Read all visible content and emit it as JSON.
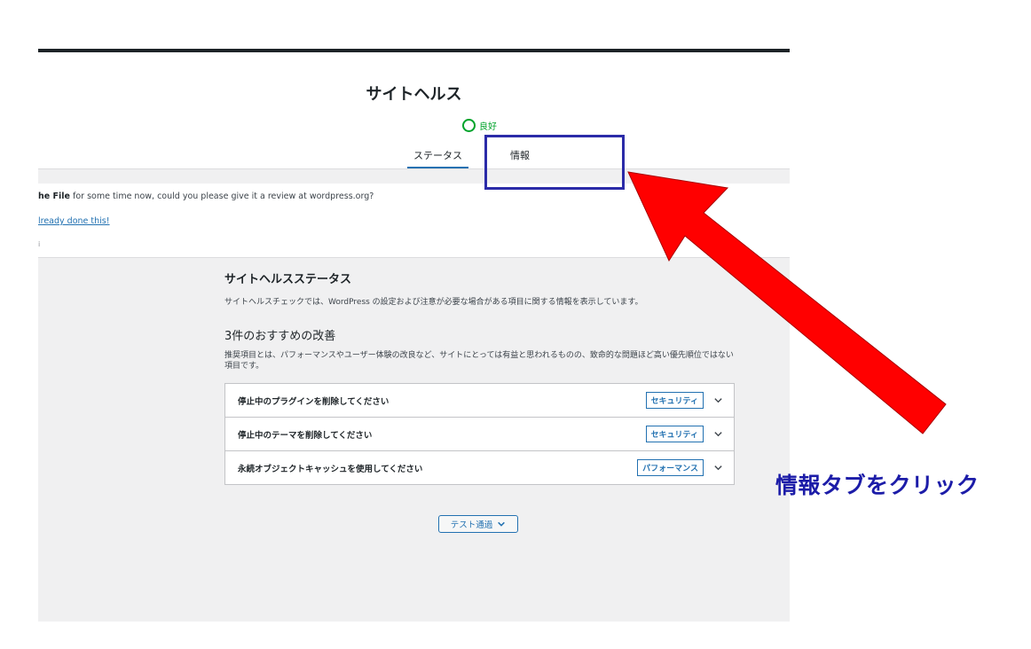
{
  "header": {
    "title": "サイトヘルス",
    "status_label": "良好",
    "tabs": [
      {
        "label": "ステータス",
        "active": true
      },
      {
        "label": "情報",
        "active": false
      }
    ]
  },
  "notice": {
    "text_bold": "he File",
    "text_rest": " for some time now, could you please give it a review at wordpress.org?",
    "link": "lready done this!",
    "dot": "i"
  },
  "status_section": {
    "title": "サイトヘルスステータス",
    "description": "サイトヘルスチェックでは、WordPress の設定および注意が必要な場合がある項目に関する情報を表示しています。"
  },
  "recommendations": {
    "title": "3件のおすすめの改善",
    "description": "推奨項目とは、パフォーマンスやユーザー体験の改良など、サイトにとっては有益と思われるものの、致命的な問題ほど高い優先順位ではない項目です。",
    "items": [
      {
        "label": "停止中のプラグインを削除してください",
        "badge": "セキュリティ"
      },
      {
        "label": "停止中のテーマを削除してください",
        "badge": "セキュリティ"
      },
      {
        "label": "永続オブジェクトキャッシュを使用してください",
        "badge": "パフォーマンス"
      }
    ]
  },
  "passed_tests_button": "テスト通過",
  "annotation": {
    "callout": "情報タブをクリック",
    "arrow_color": "#ff0000",
    "box_color": "#2b2ba8"
  },
  "colors": {
    "accent": "#2271b1",
    "good": "#00a32a"
  },
  "icons": [
    "good-status-icon",
    "chevron-down-icon"
  ]
}
